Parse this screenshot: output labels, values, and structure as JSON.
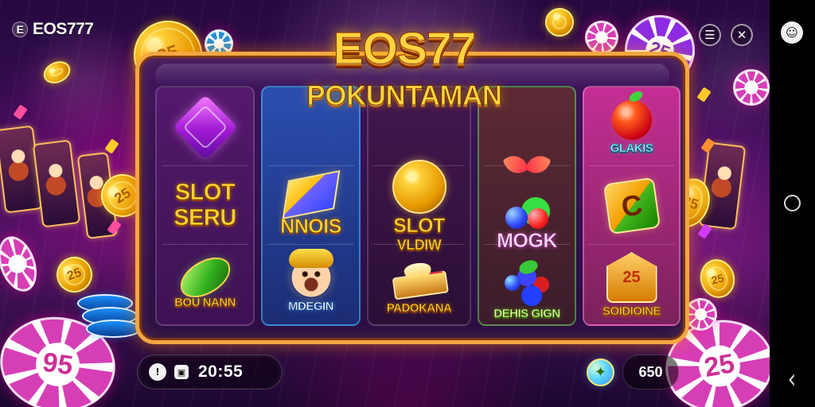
{
  "app": {
    "brand_label": "EOS777",
    "title": "EOS77",
    "subtitle": "POKUNTAMAN"
  },
  "toolbar": {
    "menu_icon": "menu-icon",
    "close_icon": "close-icon"
  },
  "navigation": {
    "avatar_icon": "avatar-icon",
    "home_icon": "home-icon",
    "back_icon": "back-icon"
  },
  "decor": {
    "coin_1": "25",
    "coin_2": "25",
    "coin_3": "25",
    "coin_4": "25",
    "coin_5": "25",
    "chip_left": "95",
    "chip_right": "25",
    "chip_top_right": "25",
    "badge": "25"
  },
  "reels": {
    "col1": {
      "mid_label_line1": "SLOT",
      "mid_label_line2": "SERU",
      "bottom_label": "BOU NANN"
    },
    "col2": {
      "mid_label": "NNOIS",
      "bottom_label": "MDEGIN"
    },
    "col3": {
      "mid_label_line1": "SLOT",
      "mid_label_line2": "VLDIW",
      "bottom_label": "PADOKANA"
    },
    "col4": {
      "mid_label": "MOGK",
      "bottom_label": "DEHIS GIGN"
    },
    "col5": {
      "top_label": "GLAKIS",
      "bottom_label": "SOIDIOINE",
      "letter": "C"
    }
  },
  "bottom_bar": {
    "left_icon_1": "timer-icon",
    "left_icon_2": "calendar-icon",
    "time_text": "20:55",
    "reward_icon": "reward-icon",
    "credits_text": "650"
  }
}
